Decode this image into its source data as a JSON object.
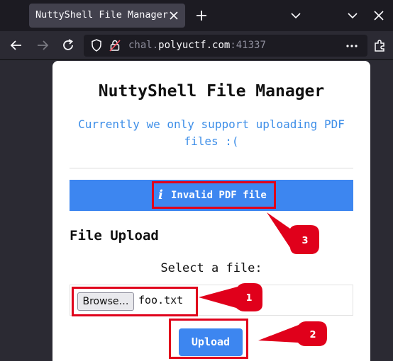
{
  "browser": {
    "tab_title": "NuttyShell File Manager",
    "url_prefix": "chal.",
    "url_domain": "polyuctf.com",
    "url_port": ":41337"
  },
  "page": {
    "heading": "NuttyShell File Manager",
    "subtext": "Currently we only support uploading PDF files :(",
    "alert_icon": "i",
    "alert_text": "Invalid PDF file",
    "section_title": "File Upload",
    "select_label": "Select a file:",
    "browse_label": "Browse…",
    "file_name": "foo.txt",
    "upload_label": "Upload"
  },
  "annotations": {
    "badge_1": "1",
    "badge_2": "2",
    "badge_3": "3",
    "highlight_color": "#e0001b"
  },
  "colors": {
    "accent_blue": "#3d86f0",
    "subtext_blue": "#3d8ee8"
  }
}
